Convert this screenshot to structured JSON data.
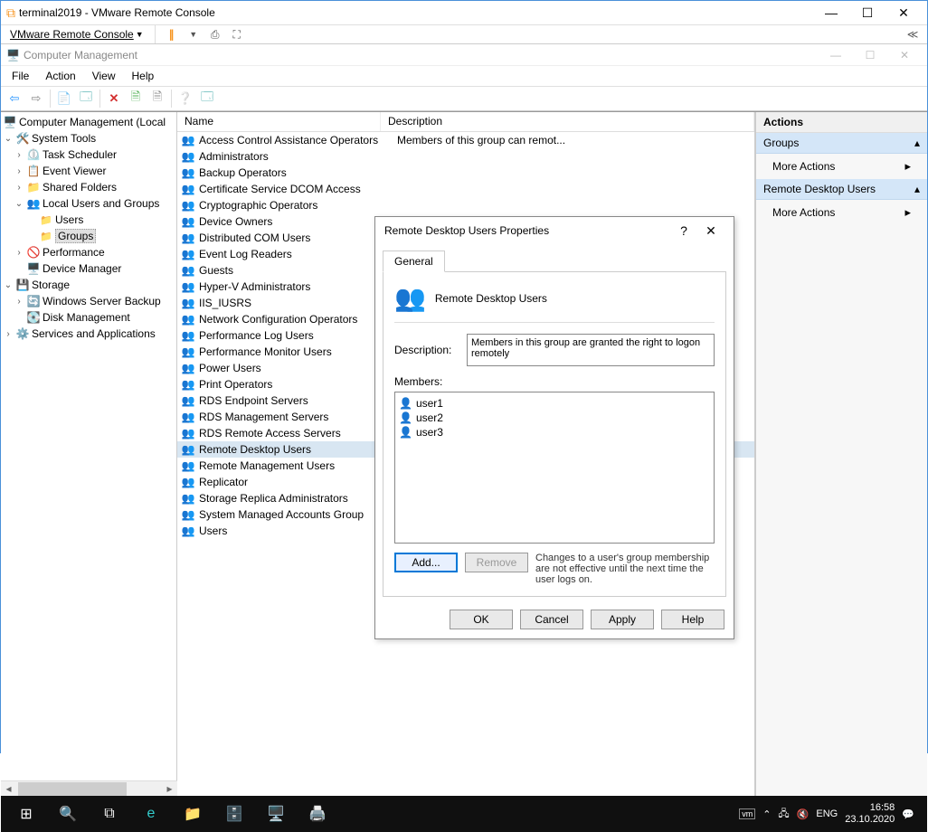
{
  "vmware": {
    "title": "terminal2019 - VMware Remote Console",
    "menu_label": "VMware Remote Console"
  },
  "cm": {
    "title": "Computer Management",
    "menubar": [
      "File",
      "Action",
      "View",
      "Help"
    ]
  },
  "tree": {
    "root": "Computer Management (Local",
    "system_tools": "System Tools",
    "task_scheduler": "Task Scheduler",
    "event_viewer": "Event Viewer",
    "shared_folders": "Shared Folders",
    "local_users_groups": "Local Users and Groups",
    "users": "Users",
    "groups": "Groups",
    "performance": "Performance",
    "device_manager": "Device Manager",
    "storage": "Storage",
    "wsb": "Windows Server Backup",
    "disk_mgmt": "Disk Management",
    "services_apps": "Services and Applications"
  },
  "list": {
    "col_name": "Name",
    "col_desc": "Description",
    "desc_visible": "Members of this group can remot...",
    "groups": [
      "Access Control Assistance Operators",
      "Administrators",
      "Backup Operators",
      "Certificate Service DCOM Access",
      "Cryptographic Operators",
      "Device Owners",
      "Distributed COM Users",
      "Event Log Readers",
      "Guests",
      "Hyper-V Administrators",
      "IIS_IUSRS",
      "Network Configuration Operators",
      "Performance Log Users",
      "Performance Monitor Users",
      "Power Users",
      "Print Operators",
      "RDS Endpoint Servers",
      "RDS Management Servers",
      "RDS Remote Access Servers",
      "Remote Desktop Users",
      "Remote Management Users",
      "Replicator",
      "Storage Replica Administrators",
      "System Managed Accounts Group",
      "Users"
    ],
    "selected_index": 19
  },
  "actions": {
    "header": "Actions",
    "groups_head": "Groups",
    "more_actions": "More Actions",
    "rdu_head": "Remote Desktop Users"
  },
  "dialog": {
    "title": "Remote Desktop Users Properties",
    "tab_general": "General",
    "group_name": "Remote Desktop Users",
    "desc_label": "Description:",
    "desc_value": "Members in this group are granted the right to logon remotely",
    "members_label": "Members:",
    "members": [
      "user1",
      "user2",
      "user3"
    ],
    "add": "Add...",
    "remove": "Remove",
    "hint": "Changes to a user's group membership are not effective until the next time the user logs on.",
    "ok": "OK",
    "cancel": "Cancel",
    "apply": "Apply",
    "help": "Help"
  },
  "taskbar": {
    "lang": "ENG",
    "time": "16:58",
    "date": "23.10.2020"
  }
}
